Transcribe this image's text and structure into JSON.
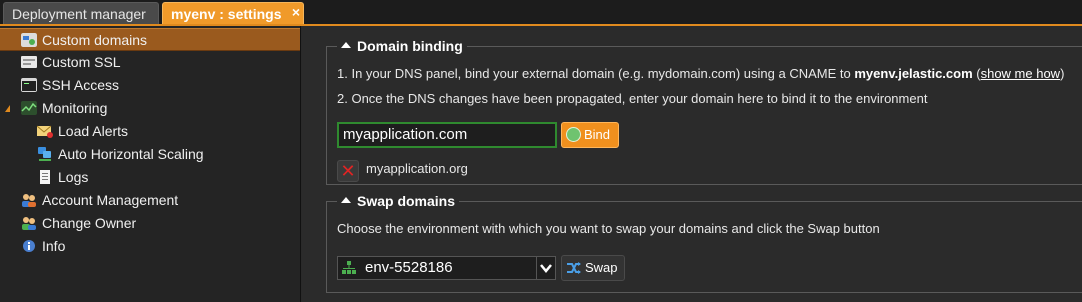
{
  "tabs": [
    {
      "label": "Deployment manager"
    },
    {
      "label": "myenv : settings",
      "close_icon": "×"
    }
  ],
  "sidebar": {
    "items": [
      {
        "label": "Custom domains",
        "icon": "custom-domains-icon"
      },
      {
        "label": "Custom SSL",
        "icon": "ssl-icon"
      },
      {
        "label": "SSH Access",
        "icon": "terminal-icon"
      },
      {
        "label": "Monitoring",
        "icon": "monitoring-icon"
      },
      {
        "label": "Load Alerts",
        "icon": "mail-alert-icon"
      },
      {
        "label": "Auto Horizontal Scaling",
        "icon": "scaling-icon"
      },
      {
        "label": "Logs",
        "icon": "document-icon"
      },
      {
        "label": "Account Management",
        "icon": "users-icon"
      },
      {
        "label": "Change Owner",
        "icon": "users-swap-icon"
      },
      {
        "label": "Info",
        "icon": "info-icon"
      }
    ]
  },
  "domain_binding": {
    "title": "Domain binding",
    "step1_prefix": "1. In your DNS panel, bind your external domain (e.g. mydomain.com) using a CNAME to",
    "step1_host": "myenv.jelastic.com",
    "step1_link": "show me how",
    "step2": "2. Once the DNS changes have been propagated, enter your domain here to bind it to the environment",
    "input_value": "myapplication.com",
    "bind_label": "Bind",
    "bound_domains": [
      "myapplication.org"
    ]
  },
  "swap_domains": {
    "title": "Swap domains",
    "description": "Choose the environment with which you want to swap your domains and click the Swap button",
    "selected_env": "env-5528186",
    "swap_label": "Swap"
  },
  "colors": {
    "accent": "#f09a2a",
    "selected": "#9a5a1e",
    "input_border": "#2f8a2f",
    "delete": "#e02424"
  }
}
